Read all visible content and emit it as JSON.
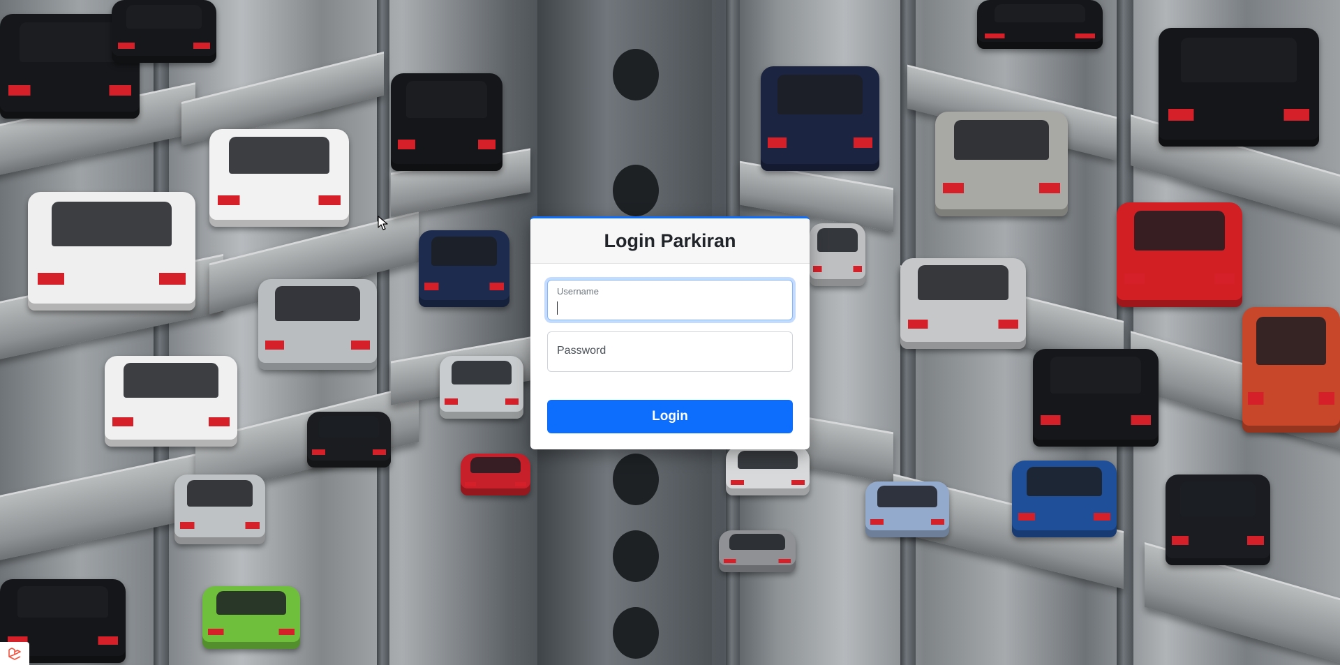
{
  "page": {
    "background": "photo-of-automated-car-parking-tower"
  },
  "login": {
    "title": "Login Parkiran",
    "username": {
      "label": "Username",
      "value": "",
      "focused": true
    },
    "password": {
      "label": "Password",
      "value": ""
    },
    "submit_label": "Login"
  },
  "colors": {
    "primary": "#0d6efd",
    "card_header": "#f7f7f8",
    "focus_ring": "#86b7fe"
  },
  "icons": {
    "cursor": "arrow-cursor-icon",
    "corner": "laravel-logo-icon"
  }
}
